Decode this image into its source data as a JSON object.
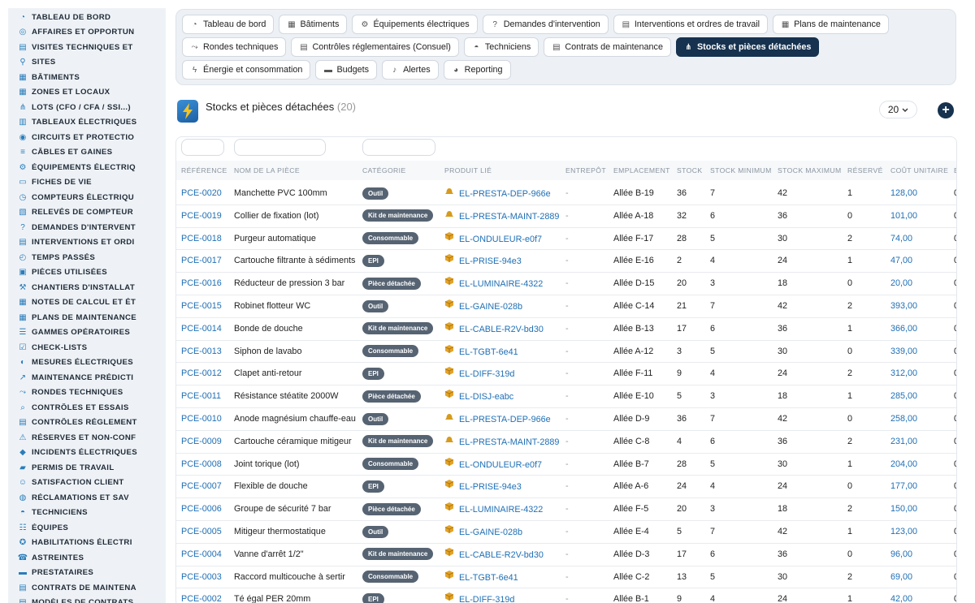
{
  "sidebar": {
    "items": [
      {
        "label": "TABLEAU DE BORD",
        "icon": "dashboard-icon"
      },
      {
        "label": "AFFAIRES ET OPPORTUN",
        "icon": "target-icon"
      },
      {
        "label": "VISITES TECHNIQUES ET",
        "icon": "clipboard-icon"
      },
      {
        "label": "SITES",
        "icon": "location-pin-icon"
      },
      {
        "label": "BÂTIMENTS",
        "icon": "building-icon"
      },
      {
        "label": "ZONES ET LOCAUX",
        "icon": "grid-icon"
      },
      {
        "label": "LOTS (CFO / CFA / SSI...)",
        "icon": "hierarchy-icon"
      },
      {
        "label": "TABLEAUX ÉLECTRIQUES",
        "icon": "table-icon"
      },
      {
        "label": "CIRCUITS ET PROTECTIO",
        "icon": "circuit-icon"
      },
      {
        "label": "CÂBLES ET GAINES",
        "icon": "cable-icon"
      },
      {
        "label": "ÉQUIPEMENTS ÉLECTRIQ",
        "icon": "gears-icon"
      },
      {
        "label": "FICHES DE VIE",
        "icon": "file-icon"
      },
      {
        "label": "COMPTEURS ÉLECTRIQU",
        "icon": "gauge-icon"
      },
      {
        "label": "RELEVÉS DE COMPTEUR",
        "icon": "chart-icon"
      },
      {
        "label": "DEMANDES D'INTERVENT",
        "icon": "question-icon"
      },
      {
        "label": "INTERVENTIONS ET ORDI",
        "icon": "wrench-list-icon"
      },
      {
        "label": "TEMPS PASSÉS",
        "icon": "clock-icon"
      },
      {
        "label": "PIÈCES UTILISÉES",
        "icon": "box-icon"
      },
      {
        "label": "CHANTIERS D'INSTALLAT",
        "icon": "hammer-icon"
      },
      {
        "label": "NOTES DE CALCUL ET ÉT",
        "icon": "calculator-icon"
      },
      {
        "label": "PLANS DE MAINTENANCE",
        "icon": "calendar-icon"
      },
      {
        "label": "GAMMES OPÉRATOIRES",
        "icon": "list-icon"
      },
      {
        "label": "CHECK-LISTS",
        "icon": "checklist-icon"
      },
      {
        "label": "MESURES ÉLECTRIQUES",
        "icon": "meter-icon"
      },
      {
        "label": "MAINTENANCE PRÉDICTI",
        "icon": "trend-icon"
      },
      {
        "label": "RONDES TECHNIQUES",
        "icon": "route-icon"
      },
      {
        "label": "CONTRÔLES ET ESSAIS",
        "icon": "search-icon"
      },
      {
        "label": "CONTRÔLES RÉGLEMENT",
        "icon": "doc-check-icon"
      },
      {
        "label": "RÉSERVES ET NON-CONF",
        "icon": "warning-icon"
      },
      {
        "label": "INCIDENTS ÉLECTRIQUES",
        "icon": "alert-icon"
      },
      {
        "label": "PERMIS DE TRAVAIL",
        "icon": "permit-icon"
      },
      {
        "label": "SATISFACTION CLIENT",
        "icon": "smile-icon"
      },
      {
        "label": "RÉCLAMATIONS ET SAV",
        "icon": "chat-icon"
      },
      {
        "label": "TECHNICIENS",
        "icon": "hardhat-icon"
      },
      {
        "label": "ÉQUIPES",
        "icon": "users-icon"
      },
      {
        "label": "HABILITATIONS ÉLECTRI",
        "icon": "badge-icon"
      },
      {
        "label": "ASTREINTES",
        "icon": "phone-icon"
      },
      {
        "label": "PRESTATAIRES",
        "icon": "truck-icon"
      },
      {
        "label": "CONTRATS DE MAINTENA",
        "icon": "contract-icon"
      },
      {
        "label": "MODÈLES DE CONTRATS",
        "icon": "template-icon"
      }
    ]
  },
  "tabs": [
    {
      "label": "Tableau de bord",
      "icon": "dashboard-icon",
      "active": false
    },
    {
      "label": "Bâtiments",
      "icon": "building-icon",
      "active": false
    },
    {
      "label": "Équipements électriques",
      "icon": "gears-icon",
      "active": false
    },
    {
      "label": "Demandes d'intervention",
      "icon": "question-icon",
      "active": false
    },
    {
      "label": "Interventions et ordres de travail",
      "icon": "clipboard-icon",
      "active": false
    },
    {
      "label": "Plans de maintenance",
      "icon": "calendar-icon",
      "active": false
    },
    {
      "label": "Rondes techniques",
      "icon": "route-icon",
      "active": false
    },
    {
      "label": "Contrôles réglementaires (Consuel)",
      "icon": "doc-check-icon",
      "active": false
    },
    {
      "label": "Techniciens",
      "icon": "hardhat-icon",
      "active": false
    },
    {
      "label": "Contrats de maintenance",
      "icon": "contract-icon",
      "active": false
    },
    {
      "label": "Stocks et pièces détachées",
      "icon": "hierarchy-icon",
      "active": true
    },
    {
      "label": "Énergie et consommation",
      "icon": "bolt-icon",
      "active": false
    },
    {
      "label": "Budgets",
      "icon": "money-icon",
      "active": false
    },
    {
      "label": "Alertes",
      "icon": "bell-icon",
      "active": false
    },
    {
      "label": "Reporting",
      "icon": "pie-icon",
      "active": false
    }
  ],
  "page": {
    "title": "Stocks et pièces détachées",
    "count": "(20)",
    "page_size": "20",
    "add_icon": "plus-circle-icon",
    "app_icon": "bolt-icon"
  },
  "table": {
    "columns": [
      "RÉFÉRENCE",
      "NOM DE LA PIÈCE",
      "CATÉGORIE",
      "PRODUIT LIÉ",
      "ENTREPÔT",
      "EMPLACEMENT",
      "STOCK",
      "STOCK MINIMUM",
      "STOCK MAXIMUM",
      "RÉSERVÉ",
      "COÛT UNITAIRE",
      "E"
    ],
    "rows": [
      {
        "ref": "PCE-0020",
        "name": "Manchette PVC 100mm",
        "cat": "Outil",
        "prod": "EL-PRESTA-DEP-966e",
        "pico": "hat",
        "wh": "-",
        "loc": "Allée B-19",
        "stock": "36",
        "min": "7",
        "max": "42",
        "res": "1",
        "cost": "128,00",
        "e": "0"
      },
      {
        "ref": "PCE-0019",
        "name": "Collier de fixation (lot)",
        "cat": "Kit de maintenance",
        "prod": "EL-PRESTA-MAINT-2889",
        "pico": "hat",
        "wh": "-",
        "loc": "Allée A-18",
        "stock": "32",
        "min": "6",
        "max": "36",
        "res": "0",
        "cost": "101,00",
        "e": "0"
      },
      {
        "ref": "PCE-0018",
        "name": "Purgeur automatique",
        "cat": "Consommable",
        "prod": "EL-ONDULEUR-e0f7",
        "pico": "box",
        "wh": "-",
        "loc": "Allée F-17",
        "stock": "28",
        "min": "5",
        "max": "30",
        "res": "2",
        "cost": "74,00",
        "e": "0"
      },
      {
        "ref": "PCE-0017",
        "name": "Cartouche filtrante à sédiments",
        "cat": "EPI",
        "prod": "EL-PRISE-94e3",
        "pico": "box",
        "wh": "-",
        "loc": "Allée E-16",
        "stock": "2",
        "min": "4",
        "max": "24",
        "res": "1",
        "cost": "47,00",
        "e": "0"
      },
      {
        "ref": "PCE-0016",
        "name": "Réducteur de pression 3 bar",
        "cat": "Pièce détachée",
        "prod": "EL-LUMINAIRE-4322",
        "pico": "box",
        "wh": "-",
        "loc": "Allée D-15",
        "stock": "20",
        "min": "3",
        "max": "18",
        "res": "0",
        "cost": "20,00",
        "e": "0"
      },
      {
        "ref": "PCE-0015",
        "name": "Robinet flotteur WC",
        "cat": "Outil",
        "prod": "EL-GAINE-028b",
        "pico": "box",
        "wh": "-",
        "loc": "Allée C-14",
        "stock": "21",
        "min": "7",
        "max": "42",
        "res": "2",
        "cost": "393,00",
        "e": "0"
      },
      {
        "ref": "PCE-0014",
        "name": "Bonde de douche",
        "cat": "Kit de maintenance",
        "prod": "EL-CABLE-R2V-bd30",
        "pico": "box",
        "wh": "-",
        "loc": "Allée B-13",
        "stock": "17",
        "min": "6",
        "max": "36",
        "res": "1",
        "cost": "366,00",
        "e": "0"
      },
      {
        "ref": "PCE-0013",
        "name": "Siphon de lavabo",
        "cat": "Consommable",
        "prod": "EL-TGBT-6e41",
        "pico": "box",
        "wh": "-",
        "loc": "Allée A-12",
        "stock": "3",
        "min": "5",
        "max": "30",
        "res": "0",
        "cost": "339,00",
        "e": "0"
      },
      {
        "ref": "PCE-0012",
        "name": "Clapet anti-retour",
        "cat": "EPI",
        "prod": "EL-DIFF-319d",
        "pico": "box",
        "wh": "-",
        "loc": "Allée F-11",
        "stock": "9",
        "min": "4",
        "max": "24",
        "res": "2",
        "cost": "312,00",
        "e": "0"
      },
      {
        "ref": "PCE-0011",
        "name": "Résistance stéatite 2000W",
        "cat": "Pièce détachée",
        "prod": "EL-DISJ-eabc",
        "pico": "box",
        "wh": "-",
        "loc": "Allée E-10",
        "stock": "5",
        "min": "3",
        "max": "18",
        "res": "1",
        "cost": "285,00",
        "e": "0"
      },
      {
        "ref": "PCE-0010",
        "name": "Anode magnésium chauffe-eau",
        "cat": "Outil",
        "prod": "EL-PRESTA-DEP-966e",
        "pico": "hat",
        "wh": "-",
        "loc": "Allée D-9",
        "stock": "36",
        "min": "7",
        "max": "42",
        "res": "0",
        "cost": "258,00",
        "e": "0"
      },
      {
        "ref": "PCE-0009",
        "name": "Cartouche céramique mitigeur",
        "cat": "Kit de maintenance",
        "prod": "EL-PRESTA-MAINT-2889",
        "pico": "hat",
        "wh": "-",
        "loc": "Allée C-8",
        "stock": "4",
        "min": "6",
        "max": "36",
        "res": "2",
        "cost": "231,00",
        "e": "0"
      },
      {
        "ref": "PCE-0008",
        "name": "Joint torique (lot)",
        "cat": "Consommable",
        "prod": "EL-ONDULEUR-e0f7",
        "pico": "box",
        "wh": "-",
        "loc": "Allée B-7",
        "stock": "28",
        "min": "5",
        "max": "30",
        "res": "1",
        "cost": "204,00",
        "e": "0"
      },
      {
        "ref": "PCE-0007",
        "name": "Flexible de douche",
        "cat": "EPI",
        "prod": "EL-PRISE-94e3",
        "pico": "box",
        "wh": "-",
        "loc": "Allée A-6",
        "stock": "24",
        "min": "4",
        "max": "24",
        "res": "0",
        "cost": "177,00",
        "e": "0"
      },
      {
        "ref": "PCE-0006",
        "name": "Groupe de sécurité 7 bar",
        "cat": "Pièce détachée",
        "prod": "EL-LUMINAIRE-4322",
        "pico": "box",
        "wh": "-",
        "loc": "Allée F-5",
        "stock": "20",
        "min": "3",
        "max": "18",
        "res": "2",
        "cost": "150,00",
        "e": "0"
      },
      {
        "ref": "PCE-0005",
        "name": "Mitigeur thermostatique",
        "cat": "Outil",
        "prod": "EL-GAINE-028b",
        "pico": "box",
        "wh": "-",
        "loc": "Allée E-4",
        "stock": "5",
        "min": "7",
        "max": "42",
        "res": "1",
        "cost": "123,00",
        "e": "0"
      },
      {
        "ref": "PCE-0004",
        "name": "Vanne d'arrêt 1/2\"",
        "cat": "Kit de maintenance",
        "prod": "EL-CABLE-R2V-bd30",
        "pico": "box",
        "wh": "-",
        "loc": "Allée D-3",
        "stock": "17",
        "min": "6",
        "max": "36",
        "res": "0",
        "cost": "96,00",
        "e": "0"
      },
      {
        "ref": "PCE-0003",
        "name": "Raccord multicouche à sertir",
        "cat": "Consommable",
        "prod": "EL-TGBT-6e41",
        "pico": "box",
        "wh": "-",
        "loc": "Allée C-2",
        "stock": "13",
        "min": "5",
        "max": "30",
        "res": "2",
        "cost": "69,00",
        "e": "0"
      },
      {
        "ref": "PCE-0002",
        "name": "Té égal PER 20mm",
        "cat": "EPI",
        "prod": "EL-DIFF-319d",
        "pico": "box",
        "wh": "-",
        "loc": "Allée B-1",
        "stock": "9",
        "min": "4",
        "max": "24",
        "res": "1",
        "cost": "42,00",
        "e": "0"
      }
    ]
  },
  "colors": {
    "accent": "#16324f",
    "link": "#1f6fb5",
    "badge": "#566372",
    "icon_amber": "#d69a1c"
  }
}
